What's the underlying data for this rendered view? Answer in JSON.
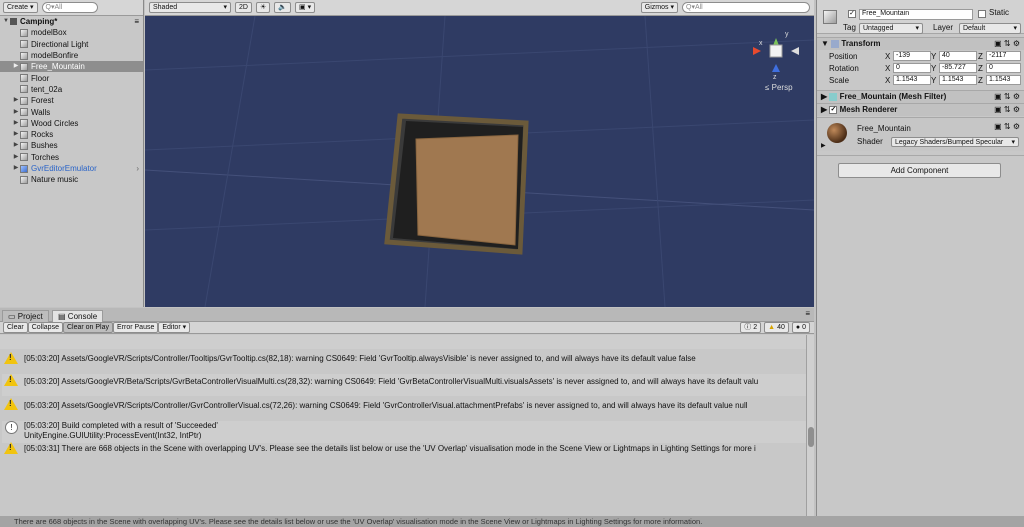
{
  "hierarchy": {
    "create_label": "Create",
    "search_placeholder": "Q▾All",
    "scene_name": "Camping*",
    "items": [
      "modelBox",
      "Directional Light",
      "modelBonfire",
      "Free_Mountain",
      "Floor",
      "tent_02a",
      "Forest",
      "Walls",
      "Wood Circles",
      "Rocks",
      "Bushes",
      "Torches",
      "GvrEditorEmulator",
      "Nature music"
    ]
  },
  "scene_toolbar": {
    "shading": "Shaded",
    "mode_2d": "2D",
    "gizmos": "Gizmos",
    "search_placeholder": "Q▾All"
  },
  "scene": {
    "axis_x": "x",
    "axis_y": "y",
    "axis_z": "z",
    "persp_label": "Persp"
  },
  "console": {
    "tabs": [
      "Project",
      "Console"
    ],
    "buttons": [
      "Clear",
      "Collapse",
      "Clear on Play",
      "Error Pause",
      "Editor"
    ],
    "counts": {
      "info": "2",
      "warnings": "40",
      "errors": "0"
    },
    "entries": [
      {
        "type": "warn",
        "text": "[05:03:20] Assets/GoogleVR/Scripts/Controller/Tooltips/GvrTooltip.cs(82,18): warning CS0649: Field 'GvrTooltip.alwaysVisible' is never assigned to, and will always have its default value false"
      },
      {
        "type": "warn",
        "text": "[05:03:20] Assets/GoogleVR/Beta/Scripts/GvrBetaControllerVisualMulti.cs(28,32): warning CS0649: Field 'GvrBetaControllerVisualMulti.visualsAssets' is never assigned to, and will always have its default valu"
      },
      {
        "type": "warn",
        "text": "[05:03:20] Assets/GoogleVR/Scripts/Controller/GvrControllerVisual.cs(72,26): warning CS0649: Field 'GvrControllerVisual.attachmentPrefabs' is never assigned to, and will always have its default value null"
      },
      {
        "type": "info",
        "text": "[05:03:20] Build completed with a result of 'Succeeded'",
        "text2": "UnityEngine.GUIUtility:ProcessEvent(Int32, IntPtr)"
      },
      {
        "type": "warn",
        "text": "[05:03:31] There are 668 objects in the Scene with overlapping UV's. Please see the details list below or use the 'UV Overlap' visualisation mode in the Scene View or Lightmaps in Lighting Settings for more i"
      }
    ]
  },
  "inspector": {
    "object_name": "Free_Mountain",
    "static_label": "Static",
    "tag_label": "Tag",
    "tag_value": "Untagged",
    "layer_label": "Layer",
    "layer_value": "Default",
    "transform": {
      "title": "Transform",
      "position_label": "Position",
      "position": {
        "x": "-139",
        "y": "40",
        "z": "-2117"
      },
      "rotation_label": "Rotation",
      "rotation": {
        "x": "0",
        "y": "-85.727",
        "z": "0"
      },
      "scale_label": "Scale",
      "scale": {
        "x": "1.1543",
        "y": "1.1543",
        "z": "1.1543"
      }
    },
    "mesh_filter": "Free_Mountain (Mesh Filter)",
    "mesh_renderer": "Mesh Renderer",
    "material": {
      "name": "Free_Mountain",
      "shader_label": "Shader",
      "shader_value": "Legacy Shaders/Bumped Specular"
    },
    "add_component": "Add Component"
  },
  "status_bar": "There are 668 objects in the Scene with overlapping UV's. Please see the details list below or use the 'UV Overlap' visualisation mode in the Scene View or Lightmaps in Lighting Settings for more information.",
  "colors": {
    "scene_bg": "#2f3b63",
    "selection": "#8e8e8e",
    "warning": "#f1c40f"
  }
}
